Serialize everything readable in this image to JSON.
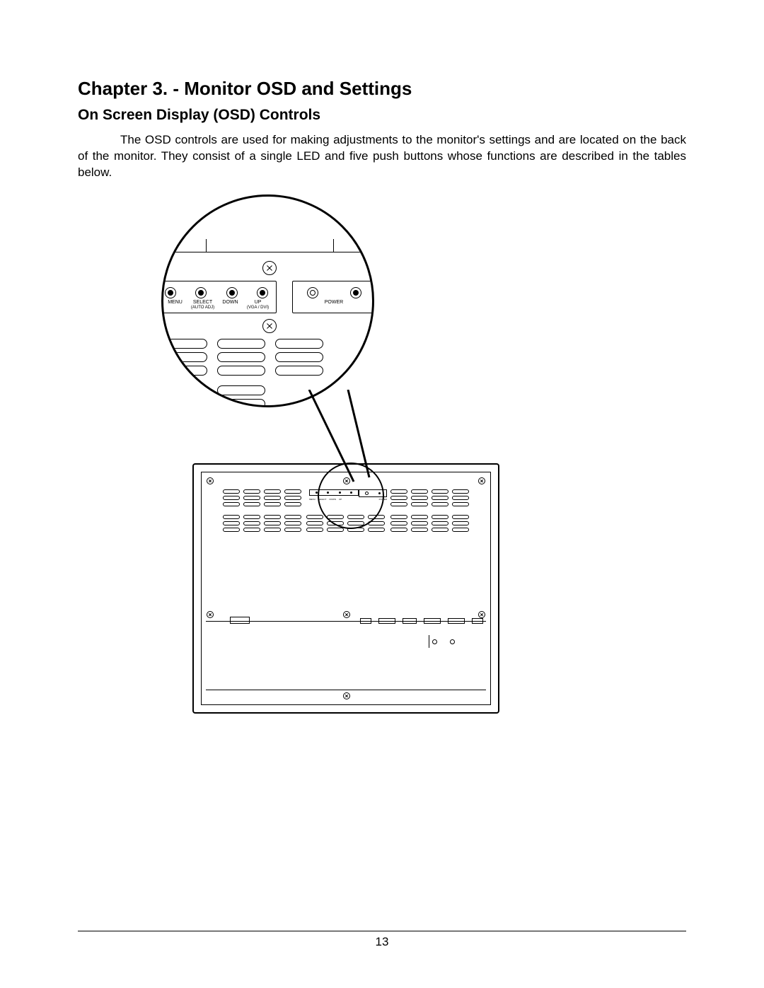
{
  "chapter_title": "Chapter 3. - Monitor OSD and Settings",
  "section_title": "On Screen Display (OSD) Controls",
  "body_text": "The OSD controls are used for making adjustments to the monitor's settings and are located on the back of the monitor. They consist of a single LED and five push buttons whose functions are described in the tables below.",
  "page_number": "13",
  "buttons": {
    "menu": {
      "label": "MENU",
      "sub": ""
    },
    "select": {
      "label": "SELECT",
      "sub": "(AUTO ADJ)"
    },
    "down": {
      "label": "DOWN",
      "sub": ""
    },
    "up": {
      "label": "UP",
      "sub": "(VGA / DVI)"
    },
    "power": {
      "label": "POWER",
      "sub": ""
    }
  }
}
